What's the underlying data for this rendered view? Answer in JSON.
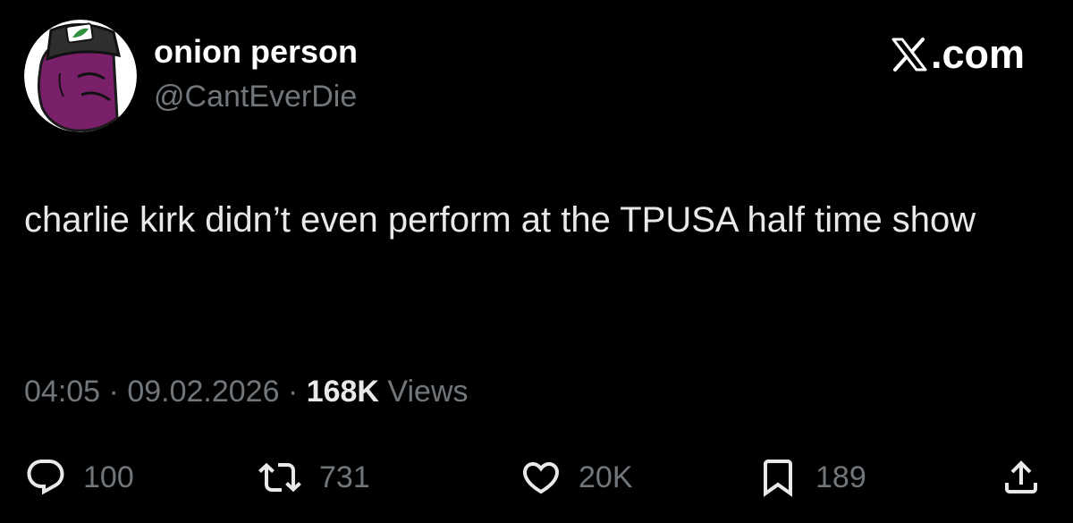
{
  "author": {
    "display_name": "onion person",
    "handle": "@CantEverDie",
    "avatar_icon": "onion-person-avatar",
    "avatar_color": "#7a1f6a"
  },
  "brand": {
    "label": ".com",
    "icon": "x-logo-icon"
  },
  "tweet": {
    "text": "charlie kirk didn’t even perform at the TPUSA half time show"
  },
  "meta": {
    "time": "04:05",
    "separator": " · ",
    "date": "09.02.2026",
    "views_count": "168K",
    "views_label": " Views"
  },
  "actions": {
    "replies": {
      "icon": "reply-icon",
      "count": "100"
    },
    "reposts": {
      "icon": "repost-icon",
      "count": "731"
    },
    "likes": {
      "icon": "heart-icon",
      "count": "20K"
    },
    "bookmarks": {
      "icon": "bookmark-icon",
      "count": "189"
    },
    "share": {
      "icon": "share-icon"
    }
  },
  "colors": {
    "background": "#000000",
    "primary_text": "#e7e9ea",
    "secondary_text": "#71767b"
  }
}
